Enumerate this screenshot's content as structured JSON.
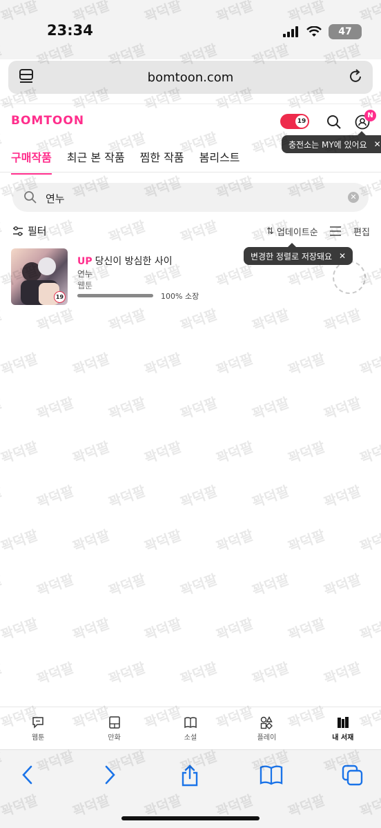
{
  "status_bar": {
    "time": "23:34",
    "battery": "47"
  },
  "browser": {
    "url": "bomtoon.com"
  },
  "header": {
    "logo": "BOMTOON",
    "adult_badge": "19",
    "profile_badge": "N",
    "charge_tooltip": "충전소는 MY에 있어요",
    "tabs": [
      {
        "label": "구매작품",
        "active": true
      },
      {
        "label": "최근 본 작품",
        "active": false
      },
      {
        "label": "찜한 작품",
        "active": false
      },
      {
        "label": "봄리스트",
        "active": false
      }
    ]
  },
  "search": {
    "value": "연누"
  },
  "filter_row": {
    "filter_label": "필터",
    "sort_label": "업데이트순",
    "edit_label": "편집",
    "sort_tooltip": "변경한 정렬로 저장돼요"
  },
  "items": [
    {
      "up_tag": "UP",
      "title": "당신이 방심한 사이",
      "author": "연누",
      "genre": "웹툰",
      "rating_badge": "19",
      "progress_label": "100% 소장",
      "progress_pct": 100
    }
  ],
  "bottom_nav": [
    {
      "label": "웹툰",
      "icon": "speech-bubble-icon",
      "active": false
    },
    {
      "label": "만화",
      "icon": "tablet-icon",
      "active": false
    },
    {
      "label": "소설",
      "icon": "book-icon",
      "active": false
    },
    {
      "label": "플레이",
      "icon": "play-shapes-icon",
      "active": false
    },
    {
      "label": "내 서재",
      "icon": "bookshelf-icon",
      "active": true
    }
  ],
  "watermark": "꽉덕팔",
  "colors": {
    "brand": "#ff2e8c",
    "adult_red": "#ee2b4c",
    "ios_blue": "#1a73e8"
  }
}
